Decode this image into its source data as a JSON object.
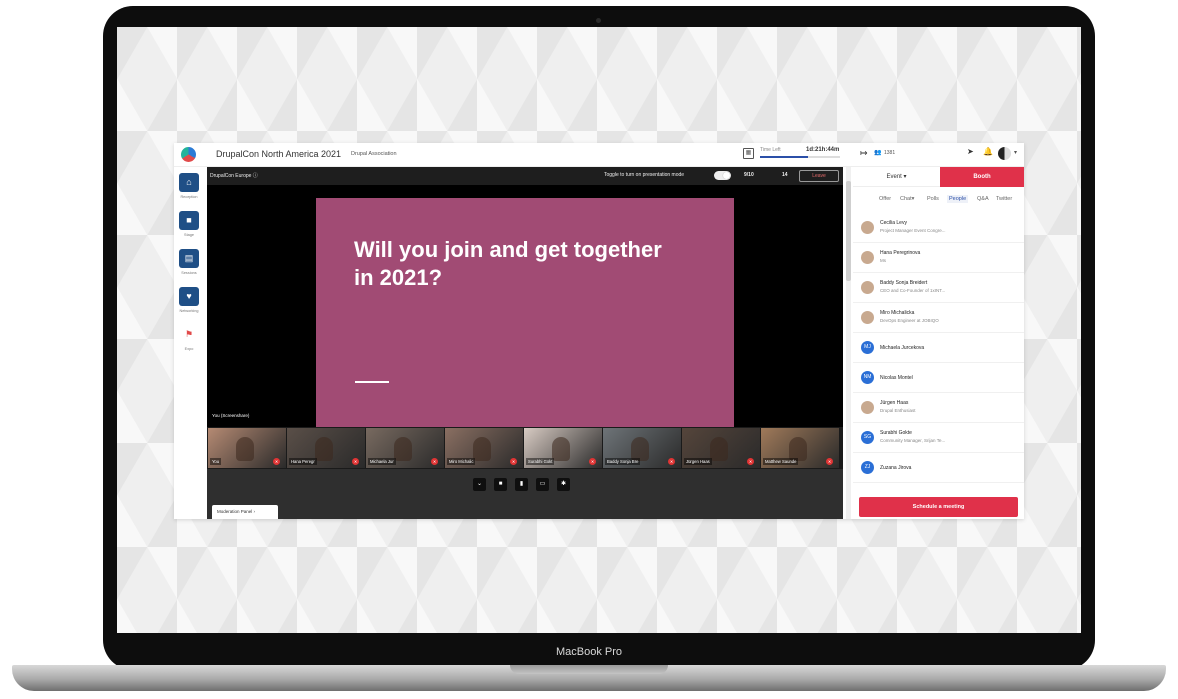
{
  "device": {
    "label": "MacBook Pro"
  },
  "topbar": {
    "event_title": "DrupalCon North America 2021",
    "organization": "Drupal Association",
    "calendar_icon": "calendar-icon",
    "time_left_label": "Time Left",
    "time_left_value": "1d:21h:44m",
    "attendee_count": "1381"
  },
  "nav": [
    {
      "label": "Reception",
      "icon": "home-icon"
    },
    {
      "label": "Stage",
      "icon": "video-camera-icon"
    },
    {
      "label": "Sessions",
      "icon": "sessions-icon"
    },
    {
      "label": "Networking",
      "icon": "networking-icon"
    },
    {
      "label": "Expo",
      "icon": "expo-icon"
    }
  ],
  "stage": {
    "name": "DrupalCon Europe ⓘ",
    "toggle_label": "Toggle to turn on presentation mode",
    "slide_counter": "9/10",
    "viewer_count": "14",
    "leave_label": "Leave",
    "slide_text": "Will you join and get together in 2021?",
    "screenshare_label": "You (Screenshare)",
    "moderation_label": "Moderation Panel ›"
  },
  "tiles": [
    {
      "name": "You",
      "color": "#b58a73"
    },
    {
      "name": "Hana Peregr",
      "color": "#5a4f48"
    },
    {
      "name": "Michaela Jur",
      "color": "#786a60"
    },
    {
      "name": "Miro Michalic",
      "color": "#8a6f62"
    },
    {
      "name": "Surabhi Gokt",
      "color": "#d8cbc3"
    },
    {
      "name": "Baddy Sonja Bre",
      "color": "#6e7478"
    },
    {
      "name": "Jürgen Haas",
      "color": "#55453b"
    },
    {
      "name": "Matthew Saunde",
      "color": "#a07a5a"
    }
  ],
  "panel": {
    "tab_event": "Event",
    "tab_booth": "Booth",
    "subtabs": [
      "Offer",
      "Chat",
      "Polls",
      "People",
      "Q&A",
      "Twitter"
    ],
    "active_subtab": "People",
    "people": [
      {
        "name": "Cecilia Levy",
        "title": "Project Manager Event Congre...",
        "initials": ""
      },
      {
        "name": "Hana Peregrinova",
        "title": "Ms",
        "initials": ""
      },
      {
        "name": "Baddy Sonja Breidert",
        "title": "CEO and Co-Founder of 1xINT...",
        "initials": ""
      },
      {
        "name": "Miro Michalicka",
        "title": "DevOps Engineer at JOBIQO",
        "initials": ""
      },
      {
        "name": "Michaela Jurcekova",
        "title": "",
        "initials": "MJ"
      },
      {
        "name": "Nicolas Montel",
        "title": "",
        "initials": "NM"
      },
      {
        "name": "Jürgen Haas",
        "title": "Drupal Enthusiast",
        "initials": ""
      },
      {
        "name": "Surabhi Gokte",
        "title": "Community Manager, Srijan Te...",
        "initials": "SG"
      },
      {
        "name": "Zuzana Jirova",
        "title": "",
        "initials": "ZJ"
      }
    ],
    "schedule_label": "Schedule a meeting"
  },
  "colors": {
    "accent": "#e0314a",
    "nav": "#1f4f86",
    "slide": "#a14b74"
  }
}
